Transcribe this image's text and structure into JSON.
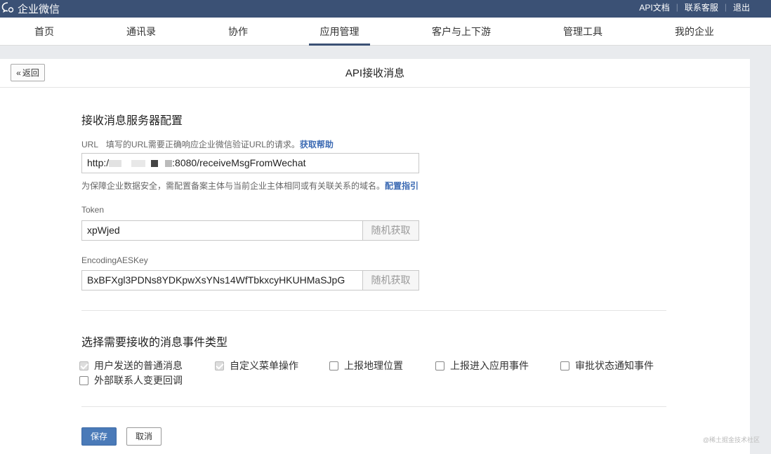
{
  "topbar": {
    "brand": "企业微信",
    "links": [
      "API文档",
      "联系客服",
      "退出"
    ],
    "separator": "|"
  },
  "nav": {
    "items": [
      "首页",
      "通讯录",
      "协作",
      "应用管理",
      "客户与上下游",
      "管理工具",
      "我的企业"
    ],
    "active": "应用管理"
  },
  "panel": {
    "back_label": "返回",
    "title": "API接收消息"
  },
  "server_config": {
    "title": "接收消息服务器配置",
    "url": {
      "label": "URL",
      "description": "填写的URL需要正确响应企业微信验证URL的请求。",
      "help_link": "获取帮助",
      "value_prefix": "http:/",
      "value_suffix": ":8080/receiveMsgFromWechat",
      "hint": "为保障企业数据安全，需配置备案主体与当前企业主体相同或有关联关系的域名。",
      "hint_link": "配置指引"
    },
    "token": {
      "label": "Token",
      "value": "xpWjed",
      "button": "随机获取"
    },
    "aeskey": {
      "label": "EncodingAESKey",
      "value": "BxBFXgl3PDNs8YDKpwXsYNs14WfTbkxcyHKUHMaSJpG",
      "button": "随机获取"
    }
  },
  "events": {
    "title": "选择需要接收的消息事件类型",
    "options": [
      {
        "label": "用户发送的普通消息",
        "checked": true
      },
      {
        "label": "自定义菜单操作",
        "checked": true
      },
      {
        "label": "上报地理位置",
        "checked": false
      },
      {
        "label": "上报进入应用事件",
        "checked": false
      },
      {
        "label": "审批状态通知事件",
        "checked": false
      },
      {
        "label": "外部联系人变更回调",
        "checked": false
      }
    ]
  },
  "actions": {
    "save": "保存",
    "cancel": "取消"
  },
  "watermark": "@稀土掘金技术社区",
  "colors": {
    "topbar_bg": "#3b5175",
    "link": "#3e6cb4",
    "save_button": "#4a7ab8"
  }
}
